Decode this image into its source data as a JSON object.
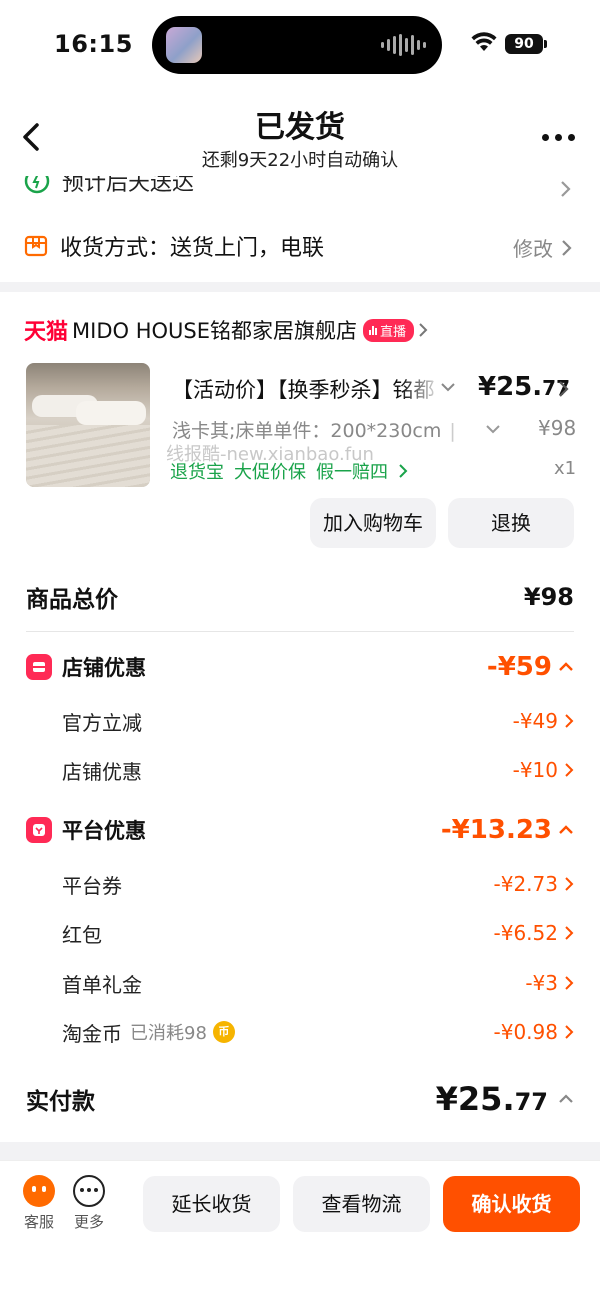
{
  "status_bar": {
    "time": "16:15",
    "battery": "90"
  },
  "header": {
    "title": "已发货",
    "subtitle": "还剩9天22小时自动确认"
  },
  "delivery": {
    "partial_row": "预计后天送达",
    "shipping_method": "收货方式：送货上门，电联",
    "edit_label": "修改"
  },
  "shop": {
    "platform": "天猫",
    "name": "MIDO HOUSE铭都家居旗舰店",
    "live_badge": "直播"
  },
  "product": {
    "title": "【活动价】【换季秒杀】铭都",
    "price_main": "¥25.",
    "price_decimal": "77",
    "spec": "浅卡其;床单单件：200*230cm",
    "original_price": "¥98",
    "watermark": "线报酷-new.xianbao.fun",
    "tags": [
      "退货宝",
      "大促价保",
      "假一赔四"
    ],
    "quantity": "x1",
    "buttons": {
      "add_cart": "加入购物车",
      "return": "退换"
    }
  },
  "summary": {
    "total_label": "商品总价",
    "total_value": "¥98",
    "store_discount": {
      "label": "店铺优惠",
      "value": "-¥59",
      "items": [
        {
          "label": "官方立减",
          "value": "-¥49"
        },
        {
          "label": "店铺优惠",
          "value": "-¥10"
        }
      ]
    },
    "platform_discount": {
      "label": "平台优惠",
      "value": "-¥13.23",
      "items": [
        {
          "label": "平台券",
          "value": "-¥2.73"
        },
        {
          "label": "红包",
          "value": "-¥6.52"
        },
        {
          "label": "首单礼金",
          "value": "-¥3"
        },
        {
          "label": "淘金币",
          "note": "已消耗98",
          "value": "-¥0.98"
        }
      ]
    },
    "paid_label": "实付款",
    "paid_main": "¥25.",
    "paid_decimal": "77"
  },
  "bottom_bar": {
    "service": "客服",
    "more": "更多",
    "extend": "延长收货",
    "logistics": "查看物流",
    "confirm": "确认收货"
  },
  "colors": {
    "accent": "#ff5000",
    "tmall": "#ff0036",
    "green_tag": "#1aa34a",
    "discount_icon": "#ff2a55"
  },
  "icons": [
    "back-chevron-icon",
    "more-dots-icon",
    "clock-icon",
    "box-icon",
    "chevron-right-icon",
    "chevron-down-icon",
    "chevron-up-icon",
    "live-bars-icon",
    "store-icon",
    "coupon-icon",
    "coin-icon",
    "service-icon",
    "more-circle-icon",
    "wifi-icon",
    "battery-icon"
  ]
}
